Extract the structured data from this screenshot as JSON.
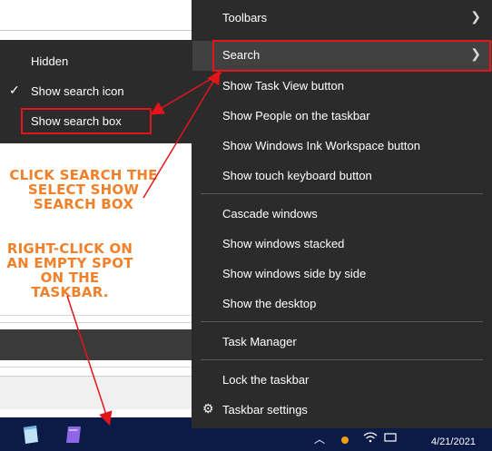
{
  "context_menu": {
    "items": [
      {
        "label": "Toolbars",
        "submenu": true
      },
      {
        "label": "Search",
        "submenu": true,
        "highlighted": true
      },
      {
        "label": "Show Task View button"
      },
      {
        "label": "Show People on the taskbar"
      },
      {
        "label": "Show Windows Ink Workspace button"
      },
      {
        "label": "Show touch keyboard button"
      },
      {
        "label": "Cascade windows"
      },
      {
        "label": "Show windows stacked"
      },
      {
        "label": "Show windows side by side"
      },
      {
        "label": "Show the desktop"
      },
      {
        "label": "Task Manager"
      },
      {
        "label": "Lock the taskbar"
      },
      {
        "label": "Taskbar settings",
        "icon": "gear-icon"
      }
    ]
  },
  "search_submenu": {
    "items": [
      {
        "label": "Hidden",
        "checked": false
      },
      {
        "label": "Show search icon",
        "checked": true
      },
      {
        "label": "Show search box",
        "checked": false
      }
    ]
  },
  "annotations": {
    "step2": "Click Search the select Show Search Box",
    "step1": "Right-click on an empty spot on the taskbar."
  },
  "taskbar": {
    "date": "4/21/2021"
  },
  "colors": {
    "menu_bg": "#2b2b2b",
    "menu_highlight": "#414141",
    "annotation": "#f0812a",
    "highlight_box": "#e3151a",
    "taskbar_bg": "#0c1a48"
  }
}
